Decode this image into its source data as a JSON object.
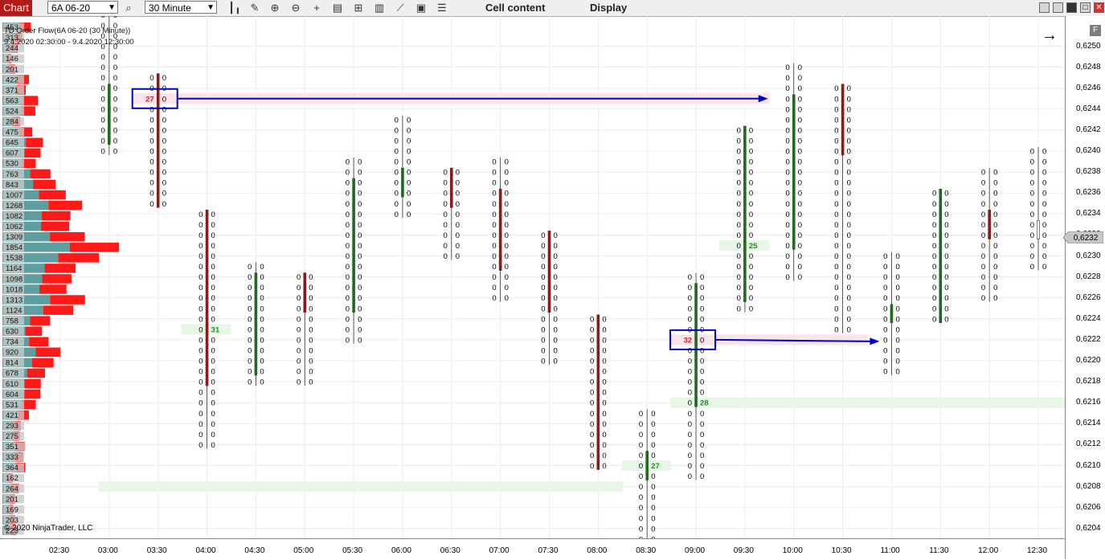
{
  "toolbar": {
    "tab_label": "Chart",
    "instrument": "6A 06-20",
    "interval": "30 Minute",
    "cell_content_label": "Cell content",
    "display_label": "Display"
  },
  "indicator": {
    "title": "TD Order Flow(6A 06-20 (30 Minute))",
    "date_range": "9.4.2020 02:30:00 - 9.4.2020 12:30:00"
  },
  "copyright": "© 2020 NinjaTrader, LLC",
  "colors": {
    "tab_red": "#b31b1b",
    "profile_teal": "#5f9ea0",
    "profile_red": "#ff1a1a",
    "bull_bar": "#1e6a1e",
    "bear_bar": "#8b1a1a",
    "imbalance_green": "#228b22",
    "imbalance_red": "#e02020",
    "zone_green": "#e6f7e6",
    "zone_pink": "#fbe3ea",
    "box_blue": "#0000cc"
  },
  "price_axis": {
    "labels": [
      "0,6250",
      "0,6248",
      "0,6246",
      "0,6244",
      "0,6242",
      "0,6240",
      "0,6238",
      "0,6236",
      "0,6234",
      "0,6232",
      "0,6230",
      "0,6228",
      "0,6226",
      "0,6224",
      "0,6222",
      "0,6220",
      "0,6218",
      "0,6216",
      "0,6214",
      "0,6212",
      "0,6210",
      "0,6208",
      "0,6206",
      "0,6204"
    ],
    "current_price": "0,6232"
  },
  "time_axis": {
    "labels": [
      "02:30",
      "03:00",
      "03:30",
      "04:00",
      "04:30",
      "05:00",
      "05:30",
      "06:00",
      "06:30",
      "07:00",
      "07:30",
      "08:00",
      "08:30",
      "09:00",
      "09:30",
      "10:00",
      "10:30",
      "11:00",
      "11:30",
      "12:00",
      "12:30"
    ]
  },
  "volume_profile": {
    "rows": [
      {
        "label": "453",
        "vol": 453
      },
      {
        "label": "313",
        "vol": 313
      },
      {
        "label": "244",
        "vol": 244
      },
      {
        "label": "146",
        "vol": 146
      },
      {
        "label": "201",
        "vol": 201
      },
      {
        "label": "422",
        "vol": 422
      },
      {
        "label": "371",
        "vol": 371
      },
      {
        "label": "563",
        "vol": 563
      },
      {
        "label": "524",
        "vol": 524
      },
      {
        "label": "284",
        "vol": 284
      },
      {
        "label": "475",
        "vol": 475
      },
      {
        "label": "645",
        "vol": 645
      },
      {
        "label": "607",
        "vol": 607
      },
      {
        "label": "530",
        "vol": 530
      },
      {
        "label": "763",
        "vol": 763
      },
      {
        "label": "843",
        "vol": 843
      },
      {
        "label": "1007",
        "vol": 1007
      },
      {
        "label": "1268",
        "vol": 1268
      },
      {
        "label": "1082",
        "vol": 1082
      },
      {
        "label": "1062",
        "vol": 1062
      },
      {
        "label": "1309",
        "vol": 1309
      },
      {
        "label": "1854",
        "vol": 1854
      },
      {
        "label": "1538",
        "vol": 1538
      },
      {
        "label": "1164",
        "vol": 1164
      },
      {
        "label": "1098",
        "vol": 1098
      },
      {
        "label": "1018",
        "vol": 1018
      },
      {
        "label": "1313",
        "vol": 1313
      },
      {
        "label": "1124",
        "vol": 1124
      },
      {
        "label": "758",
        "vol": 758
      },
      {
        "label": "630",
        "vol": 630
      },
      {
        "label": "734",
        "vol": 734
      },
      {
        "label": "920",
        "vol": 920
      },
      {
        "label": "814",
        "vol": 814
      },
      {
        "label": "678",
        "vol": 678
      },
      {
        "label": "610",
        "vol": 610
      },
      {
        "label": "604",
        "vol": 604
      },
      {
        "label": "531",
        "vol": 531
      },
      {
        "label": "421",
        "vol": 421
      },
      {
        "label": "293",
        "vol": 293
      },
      {
        "label": "275",
        "vol": 275
      },
      {
        "label": "351",
        "vol": 351
      },
      {
        "label": "333",
        "vol": 333
      },
      {
        "label": "364",
        "vol": 364
      },
      {
        "label": "162",
        "vol": 162
      },
      {
        "label": "264",
        "vol": 264
      },
      {
        "label": "201",
        "vol": 201
      },
      {
        "label": "169",
        "vol": 169
      },
      {
        "label": "203",
        "vol": 203
      },
      {
        "label": "223",
        "vol": 223
      }
    ]
  },
  "chart_data": {
    "type": "footprint",
    "price_tick": 0.0001,
    "bars": [
      {
        "time": "03:00",
        "high": 0.6253,
        "low": 0.624,
        "bar_from": 0.6246,
        "bar_to": 0.6241,
        "dir": "up"
      },
      {
        "time": "03:30",
        "high": 0.6247,
        "low": 0.6235,
        "bar_from": 0.6247,
        "bar_to": 0.6235,
        "dir": "down",
        "mark_price": 0.6245,
        "mark_text": "27"
      },
      {
        "time": "04:00",
        "high": 0.6234,
        "low": 0.6212,
        "bar_from": 0.6234,
        "bar_to": 0.6218,
        "dir": "down",
        "imbalance_price": 0.6223,
        "imbalance_text": "31"
      },
      {
        "time": "04:30",
        "high": 0.6229,
        "low": 0.6218,
        "bar_from": 0.6228,
        "bar_to": 0.6219,
        "dir": "up"
      },
      {
        "time": "05:00",
        "high": 0.6228,
        "low": 0.6218,
        "bar_from": 0.6228,
        "bar_to": 0.6225,
        "dir": "down"
      },
      {
        "time": "05:30",
        "high": 0.6239,
        "low": 0.6222,
        "bar_from": 0.6237,
        "bar_to": 0.6225,
        "dir": "up"
      },
      {
        "time": "06:00",
        "high": 0.6243,
        "low": 0.6234,
        "bar_from": 0.6238,
        "bar_to": 0.6236,
        "dir": "up"
      },
      {
        "time": "06:30",
        "high": 0.6238,
        "low": 0.623,
        "bar_from": 0.6238,
        "bar_to": 0.6235,
        "dir": "down"
      },
      {
        "time": "07:00",
        "high": 0.6239,
        "low": 0.6226,
        "bar_from": 0.6236,
        "bar_to": 0.6229,
        "dir": "down"
      },
      {
        "time": "07:30",
        "high": 0.6232,
        "low": 0.622,
        "bar_from": 0.6232,
        "bar_to": 0.6225,
        "dir": "down"
      },
      {
        "time": "08:00",
        "high": 0.6224,
        "low": 0.621,
        "bar_from": 0.6224,
        "bar_to": 0.621,
        "dir": "down"
      },
      {
        "time": "08:30",
        "high": 0.6215,
        "low": 0.6203,
        "bar_from": 0.6209,
        "bar_to": 0.6211,
        "dir": "up",
        "imbalance_price": 0.621,
        "imbalance_text": "27"
      },
      {
        "time": "09:00",
        "high": 0.6228,
        "low": 0.6209,
        "bar_from": 0.6216,
        "bar_to": 0.6227,
        "dir": "up",
        "mark_price": 0.6222,
        "mark_text": "32",
        "imbalance_price": 0.6216,
        "imbalance_text": "28"
      },
      {
        "time": "09:30",
        "high": 0.6242,
        "low": 0.6225,
        "bar_from": 0.6226,
        "bar_to": 0.6242,
        "dir": "up",
        "imbalance_price": 0.6231,
        "imbalance_text": "25"
      },
      {
        "time": "10:00",
        "high": 0.6248,
        "low": 0.6228,
        "bar_from": 0.6231,
        "bar_to": 0.6245,
        "dir": "up"
      },
      {
        "time": "10:30",
        "high": 0.6246,
        "low": 0.6223,
        "bar_from": 0.6246,
        "bar_to": 0.624,
        "dir": "down"
      },
      {
        "time": "11:00",
        "high": 0.623,
        "low": 0.6219,
        "bar_from": 0.6225,
        "bar_to": 0.6224,
        "dir": "up"
      },
      {
        "time": "11:30",
        "high": 0.6236,
        "low": 0.6224,
        "bar_from": 0.6224,
        "bar_to": 0.6236,
        "dir": "up"
      },
      {
        "time": "12:00",
        "high": 0.6238,
        "low": 0.6226,
        "bar_from": 0.6234,
        "bar_to": 0.6232,
        "dir": "down"
      },
      {
        "time": "12:30",
        "high": 0.624,
        "low": 0.6229,
        "bar_from": 0.6232,
        "bar_to": 0.6233,
        "dir": "neutral"
      }
    ],
    "zones": [
      {
        "kind": "green",
        "price": 0.6208,
        "from": "03:00",
        "to": "08:30"
      },
      {
        "kind": "green",
        "price": 0.6216,
        "from": "09:00",
        "to": "end"
      },
      {
        "kind": "green",
        "price": 0.621,
        "from": "08:30",
        "to": "08:30"
      },
      {
        "kind": "green",
        "price": 0.6223,
        "from": "04:00",
        "to": "04:00"
      },
      {
        "kind": "green",
        "price": 0.6231,
        "from": "09:30",
        "to": "09:30"
      },
      {
        "kind": "pink",
        "price": 0.6245,
        "from": "03:30",
        "to": "10:00"
      },
      {
        "kind": "pink",
        "price": 0.6222,
        "from": "09:00",
        "to": "11:00"
      }
    ],
    "cell_value": "0"
  }
}
